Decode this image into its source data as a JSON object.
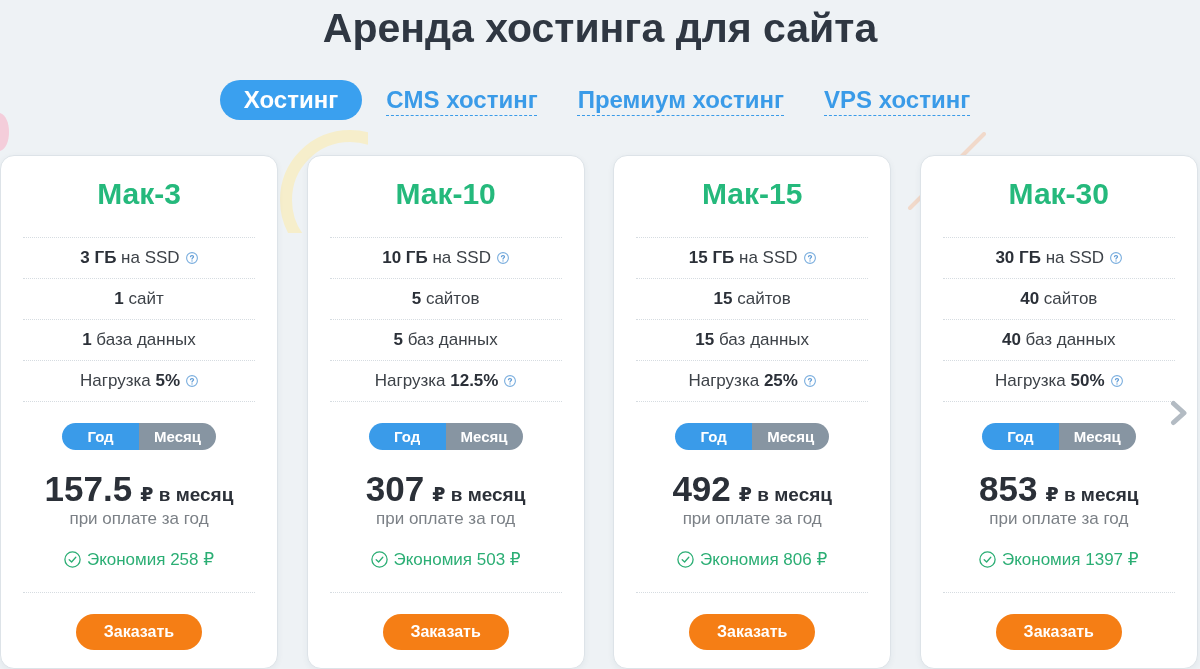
{
  "title": "Аренда хостинга для сайта",
  "tabs": [
    {
      "label": "Хостинг",
      "selected": true
    },
    {
      "label": "CMS хостинг",
      "selected": false
    },
    {
      "label": "Премиум хостинг",
      "selected": false
    },
    {
      "label": "VPS хостинг",
      "selected": false
    }
  ],
  "plans": [
    {
      "name": "Мак-3",
      "features": [
        {
          "text": "**3 ГБ** на SSD",
          "help": true
        },
        {
          "text": "**1** сайт",
          "help": false
        },
        {
          "text": "**1** база данных",
          "help": false
        },
        {
          "text": "Нагрузка **5%**",
          "help": true
        }
      ],
      "billing": [
        {
          "label": "Год",
          "selected": true
        },
        {
          "label": "Месяц",
          "selected": false
        }
      ],
      "price": "157.5",
      "price_unit": "₽ в месяц",
      "price_note": "при оплате за год",
      "savings": "Экономия 258 ₽",
      "order_button": "Заказать"
    },
    {
      "name": "Мак-10",
      "features": [
        {
          "text": "**10 ГБ** на SSD",
          "help": true
        },
        {
          "text": "**5** сайтов",
          "help": false
        },
        {
          "text": "**5** баз данных",
          "help": false
        },
        {
          "text": "Нагрузка **12.5%**",
          "help": true
        }
      ],
      "billing": [
        {
          "label": "Год",
          "selected": true
        },
        {
          "label": "Месяц",
          "selected": false
        }
      ],
      "price": "307",
      "price_unit": "₽ в месяц",
      "price_note": "при оплате за год",
      "savings": "Экономия 503 ₽",
      "order_button": "Заказать"
    },
    {
      "name": "Мак-15",
      "features": [
        {
          "text": "**15 ГБ** на SSD",
          "help": true
        },
        {
          "text": "**15** сайтов",
          "help": false
        },
        {
          "text": "**15** баз данных",
          "help": false
        },
        {
          "text": "Нагрузка **25%**",
          "help": true
        }
      ],
      "billing": [
        {
          "label": "Год",
          "selected": true
        },
        {
          "label": "Месяц",
          "selected": false
        }
      ],
      "price": "492",
      "price_unit": "₽ в месяц",
      "price_note": "при оплате за год",
      "savings": "Экономия 806 ₽",
      "order_button": "Заказать"
    },
    {
      "name": "Мак-30",
      "features": [
        {
          "text": "**30 ГБ** на SSD",
          "help": true
        },
        {
          "text": "**40** сайтов",
          "help": false
        },
        {
          "text": "**40** баз данных",
          "help": false
        },
        {
          "text": "Нагрузка **50%**",
          "help": true
        }
      ],
      "billing": [
        {
          "label": "Год",
          "selected": true
        },
        {
          "label": "Месяц",
          "selected": false
        }
      ],
      "price": "853",
      "price_unit": "₽ в месяц",
      "price_note": "при оплате за год",
      "savings": "Экономия 1397 ₽",
      "order_button": "Заказать"
    }
  ]
}
